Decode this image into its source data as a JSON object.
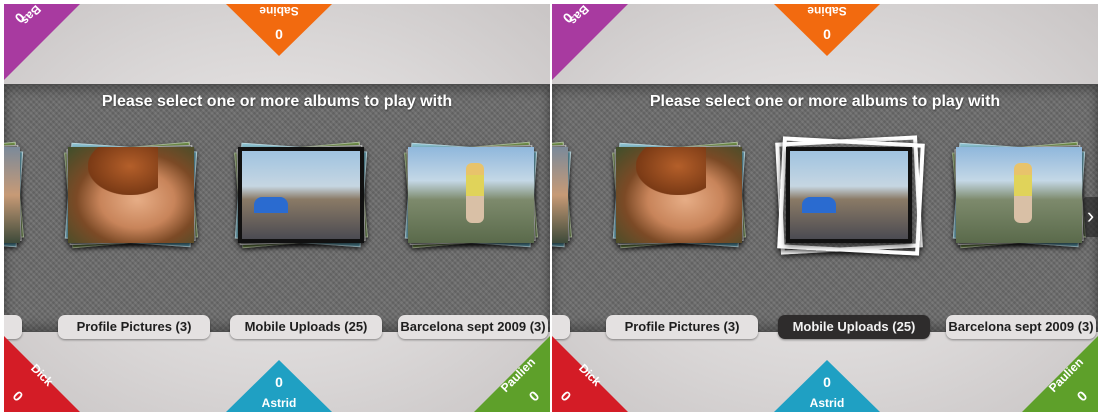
{
  "prompt": "Please select one or more albums to play with",
  "players": {
    "top": {
      "name": "Sabine",
      "score": "0",
      "color": "#f26a0f"
    },
    "bottom": {
      "name": "Astrid",
      "score": "0",
      "color": "#1fa0c3"
    },
    "top_left": {
      "name": "Bas",
      "score": "0",
      "color": "#a83aa0"
    },
    "bottom_left": {
      "name": "Dick",
      "score": "0",
      "color": "#d41c26"
    },
    "bottom_right": {
      "name": "Paulien",
      "score": "0",
      "color": "#5ea02a"
    }
  },
  "albums": [
    {
      "label": "Profile Pictures (3)"
    },
    {
      "label": "Mobile Uploads (25)"
    },
    {
      "label": "Barcelona sept 2009 (3)"
    }
  ],
  "selected_album_right_panel": "Mobile Uploads (25)",
  "next_arrow": "›"
}
